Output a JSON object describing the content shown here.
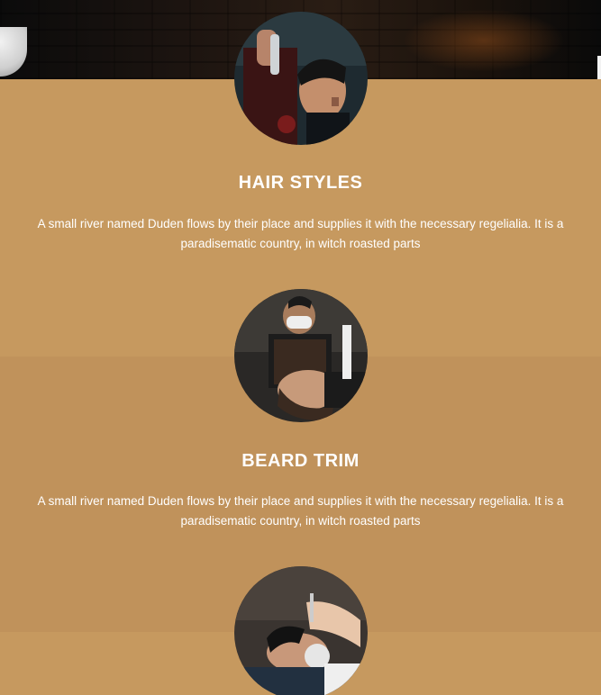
{
  "services": [
    {
      "title": "HAIR STYLES",
      "description": "A small river named Duden flows by their place and supplies it with the necessary regelialia. It is a paradisematic country, in witch roasted parts",
      "image_icon": "hair-styling-photo"
    },
    {
      "title": "BEARD TRIM",
      "description": "A small river named Duden flows by their place and supplies it with the necessary regelialia. It is a paradisematic country, in witch roasted parts",
      "image_icon": "beard-trim-photo"
    },
    {
      "title": "",
      "description": "",
      "image_icon": "shaving-photo"
    }
  ],
  "colors": {
    "background": "#c6995f",
    "band_alt": "#c0925b",
    "text": "#ffffff"
  }
}
